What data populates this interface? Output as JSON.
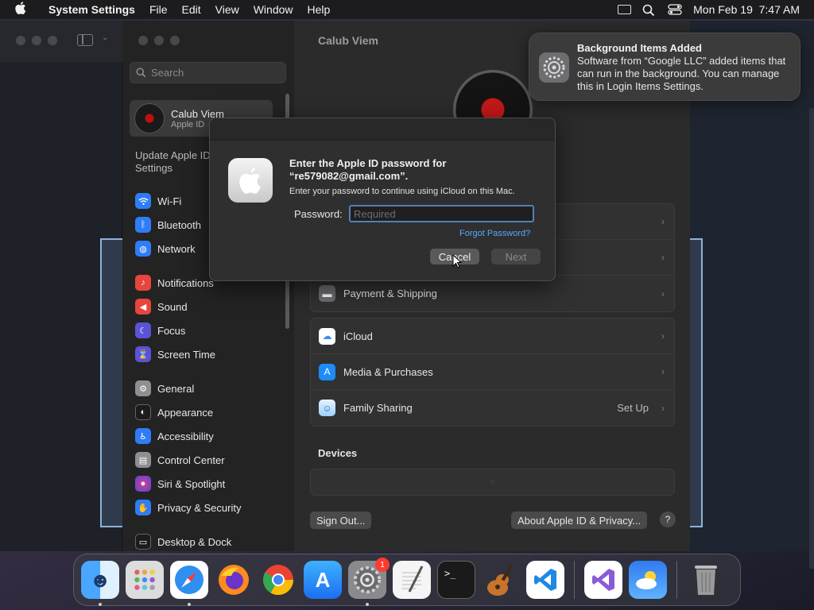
{
  "menubar": {
    "app_name": "System Settings",
    "items": [
      "File",
      "Edit",
      "View",
      "Window",
      "Help"
    ],
    "datetime": "Mon Feb 19  7:47 AM"
  },
  "sidebar": {
    "search_placeholder": "Search",
    "profile": {
      "name": "Calub Viem",
      "sub": "Apple ID"
    },
    "update_note": "Update Apple ID Settings",
    "items": [
      {
        "label": "Wi-Fi",
        "icon": "wifi-icon",
        "color": "#2e7cf6"
      },
      {
        "label": "Bluetooth",
        "icon": "bluetooth-icon",
        "color": "#2e7cf6"
      },
      {
        "label": "Network",
        "icon": "network-icon",
        "color": "#2e7cf6"
      },
      {
        "label": "Notifications",
        "icon": "bell-icon",
        "color": "#e8453c"
      },
      {
        "label": "Sound",
        "icon": "speaker-icon",
        "color": "#e8453c"
      },
      {
        "label": "Focus",
        "icon": "moon-icon",
        "color": "#5b53d6"
      },
      {
        "label": "Screen Time",
        "icon": "hourglass-icon",
        "color": "#5b53d6"
      },
      {
        "label": "General",
        "icon": "gear-icon",
        "color": "#8e8e93"
      },
      {
        "label": "Appearance",
        "icon": "appearance-icon",
        "color": "#1c1c1e"
      },
      {
        "label": "Accessibility",
        "icon": "accessibility-icon",
        "color": "#2e7cf6"
      },
      {
        "label": "Control Center",
        "icon": "control-center-icon",
        "color": "#8e8e93"
      },
      {
        "label": "Siri & Spotlight",
        "icon": "siri-icon",
        "color": "#9b4bd8"
      },
      {
        "label": "Privacy & Security",
        "icon": "hand-icon",
        "color": "#2e7cf6"
      },
      {
        "label": "Desktop & Dock",
        "icon": "desktop-icon",
        "color": "#1c1c1e"
      }
    ]
  },
  "main": {
    "title": "Calub Viem",
    "payment_row": "Payment & Shipping",
    "services": [
      {
        "label": "iCloud",
        "value": ""
      },
      {
        "label": "Media & Purchases",
        "value": ""
      },
      {
        "label": "Family Sharing",
        "value": "Set Up"
      }
    ],
    "devices_title": "Devices",
    "sign_out": "Sign Out...",
    "about": "About Apple ID & Privacy...",
    "help": "?"
  },
  "dialog": {
    "title": "Enter the Apple ID password for “re579082@gmail.com”.",
    "subtitle": "Enter your password to continue using iCloud on this Mac.",
    "password_label": "Password:",
    "password_placeholder": "Required",
    "forgot": "Forgot Password?",
    "cancel": "Cancel",
    "next": "Next"
  },
  "notification": {
    "title": "Background Items Added",
    "body": "Software from “Google LLC” added items that can run in the background. You can manage this in Login Items Settings."
  },
  "dock": {
    "settings_badge": "1"
  }
}
